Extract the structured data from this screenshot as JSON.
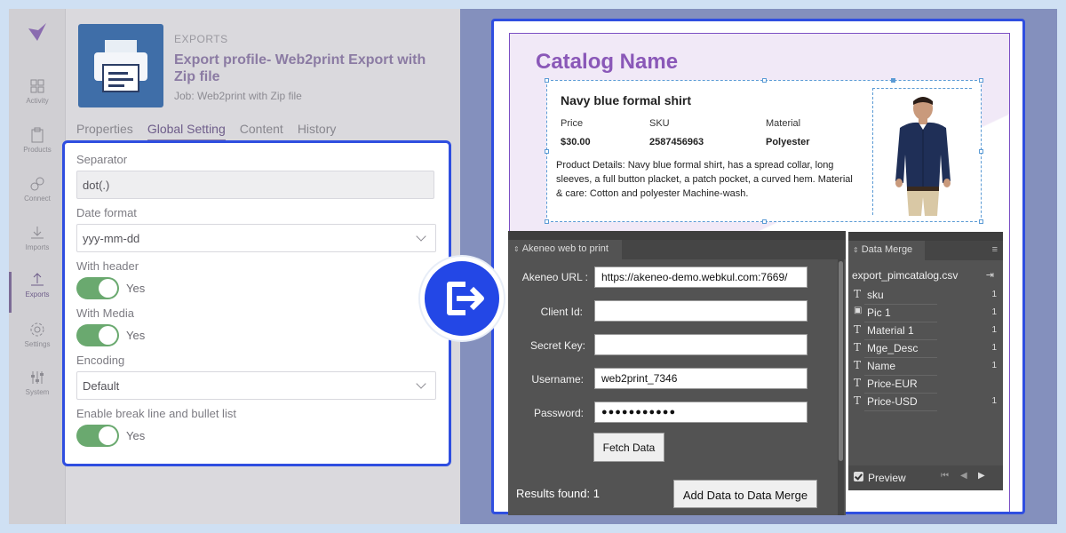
{
  "akeneo": {
    "nav": [
      {
        "label": "Activity",
        "icon": "dashboard-icon"
      },
      {
        "label": "Products",
        "icon": "clipboard-icon"
      },
      {
        "label": "Connect",
        "icon": "link-icon"
      },
      {
        "label": "Imports",
        "icon": "import-icon"
      },
      {
        "label": "Exports",
        "icon": "export-icon",
        "active": true
      },
      {
        "label": "Settings",
        "icon": "gear-icon"
      },
      {
        "label": "System",
        "icon": "sliders-icon"
      }
    ],
    "kicker": "EXPORTS",
    "profile_title": "Export profile- Web2print Export with Zip file",
    "job": "Job: Web2print with Zip file",
    "tabs": [
      "Properties",
      "Global Setting",
      "Content",
      "History"
    ],
    "form": {
      "separator_label": "Separator",
      "separator_value": "dot(.)",
      "date_format_label": "Date format",
      "date_format_value": "yyy-mm-dd",
      "with_header_label": "With header",
      "with_header_value": "Yes",
      "with_media_label": "With Media",
      "with_media_value": "Yes",
      "encoding_label": "Encoding",
      "encoding_value": "Default",
      "break_line_label": "Enable break line and bullet list",
      "break_line_value": "Yes"
    }
  },
  "catalog": {
    "title": "Catalog Name",
    "product_name": "Navy blue formal shirt",
    "headers": [
      "Price",
      "SKU",
      "Material"
    ],
    "values": [
      "$30.00",
      "2587456963",
      "Polyester"
    ],
    "description": "Product Details: Navy blue formal shirt, has a spread collar, long sleeves, a full button placket, a patch pocket, a curved hem. Material & care: Cotton and polyester Machine-wash."
  },
  "web2print": {
    "tab": "Akeneo web to print",
    "url_label": "Akeneo URL :",
    "url_value": "https://akeneo-demo.webkul.com:7669/",
    "client_id_label": "Client Id:",
    "client_id_value": "",
    "secret_label": "Secret Key:",
    "secret_value": "",
    "username_label": "Username:",
    "username_value": "web2print_7346",
    "password_label": "Password:",
    "password_value": "●●●●●●●●●●●",
    "fetch_button": "Fetch Data",
    "results": "Results found: 1",
    "add_button": "Add Data to Data Merge"
  },
  "data_merge": {
    "tab": "Data Merge",
    "file": "export_pimcatalog.csv",
    "fields": [
      {
        "type": "T",
        "name": "sku",
        "count": "1"
      },
      {
        "type": "img",
        "name": "Pic 1",
        "count": "1"
      },
      {
        "type": "T",
        "name": "Material 1",
        "count": "1"
      },
      {
        "type": "T",
        "name": "Mge_Desc",
        "count": "1"
      },
      {
        "type": "T",
        "name": "Name",
        "count": "1"
      },
      {
        "type": "T",
        "name": "Price-EUR",
        "count": ""
      },
      {
        "type": "T",
        "name": "Price-USD",
        "count": "1"
      }
    ],
    "preview": "Preview"
  },
  "colors": {
    "accent_blue": "#2f4ee0",
    "catalog_purple": "#8a58b8",
    "toggle_green": "#6aa96f"
  }
}
